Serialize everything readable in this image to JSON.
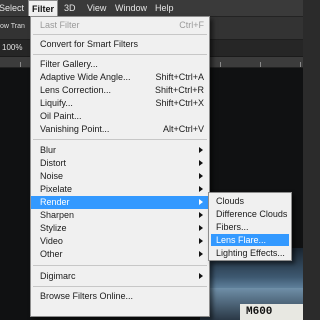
{
  "menubar": {
    "items": [
      "Select",
      "Filter",
      "3D",
      "View",
      "Window",
      "Help"
    ]
  },
  "options_bar": {
    "text": "ow Tran"
  },
  "tab_bar": {
    "zoom": "100%"
  },
  "filter_menu": {
    "items": [
      {
        "label": "Last Filter",
        "shortcut": "Ctrl+F",
        "disabled": true
      },
      {
        "label": "Convert for Smart Filters"
      },
      {
        "label": "Filter Gallery..."
      },
      {
        "label": "Adaptive Wide Angle...",
        "shortcut": "Shift+Ctrl+A"
      },
      {
        "label": "Lens Correction...",
        "shortcut": "Shift+Ctrl+R"
      },
      {
        "label": "Liquify...",
        "shortcut": "Shift+Ctrl+X"
      },
      {
        "label": "Oil Paint..."
      },
      {
        "label": "Vanishing Point...",
        "shortcut": "Alt+Ctrl+V"
      },
      {
        "label": "Blur",
        "submenu": true
      },
      {
        "label": "Distort",
        "submenu": true
      },
      {
        "label": "Noise",
        "submenu": true
      },
      {
        "label": "Pixelate",
        "submenu": true
      },
      {
        "label": "Render",
        "submenu": true,
        "highlighted": true
      },
      {
        "label": "Sharpen",
        "submenu": true
      },
      {
        "label": "Stylize",
        "submenu": true
      },
      {
        "label": "Video",
        "submenu": true
      },
      {
        "label": "Other",
        "submenu": true
      },
      {
        "label": "Digimarc",
        "submenu": true
      },
      {
        "label": "Browse Filters Online..."
      }
    ]
  },
  "render_submenu": {
    "items": [
      {
        "label": "Clouds"
      },
      {
        "label": "Difference Clouds"
      },
      {
        "label": "Fibers..."
      },
      {
        "label": "Lens Flare...",
        "highlighted": true
      },
      {
        "label": "Lighting Effects..."
      }
    ]
  },
  "canvas": {
    "plate_text": "M600"
  },
  "colors": {
    "menu_bg": "#f0f0f0",
    "highlight": "#3399ff",
    "app_bg": "#2b2b2b"
  }
}
